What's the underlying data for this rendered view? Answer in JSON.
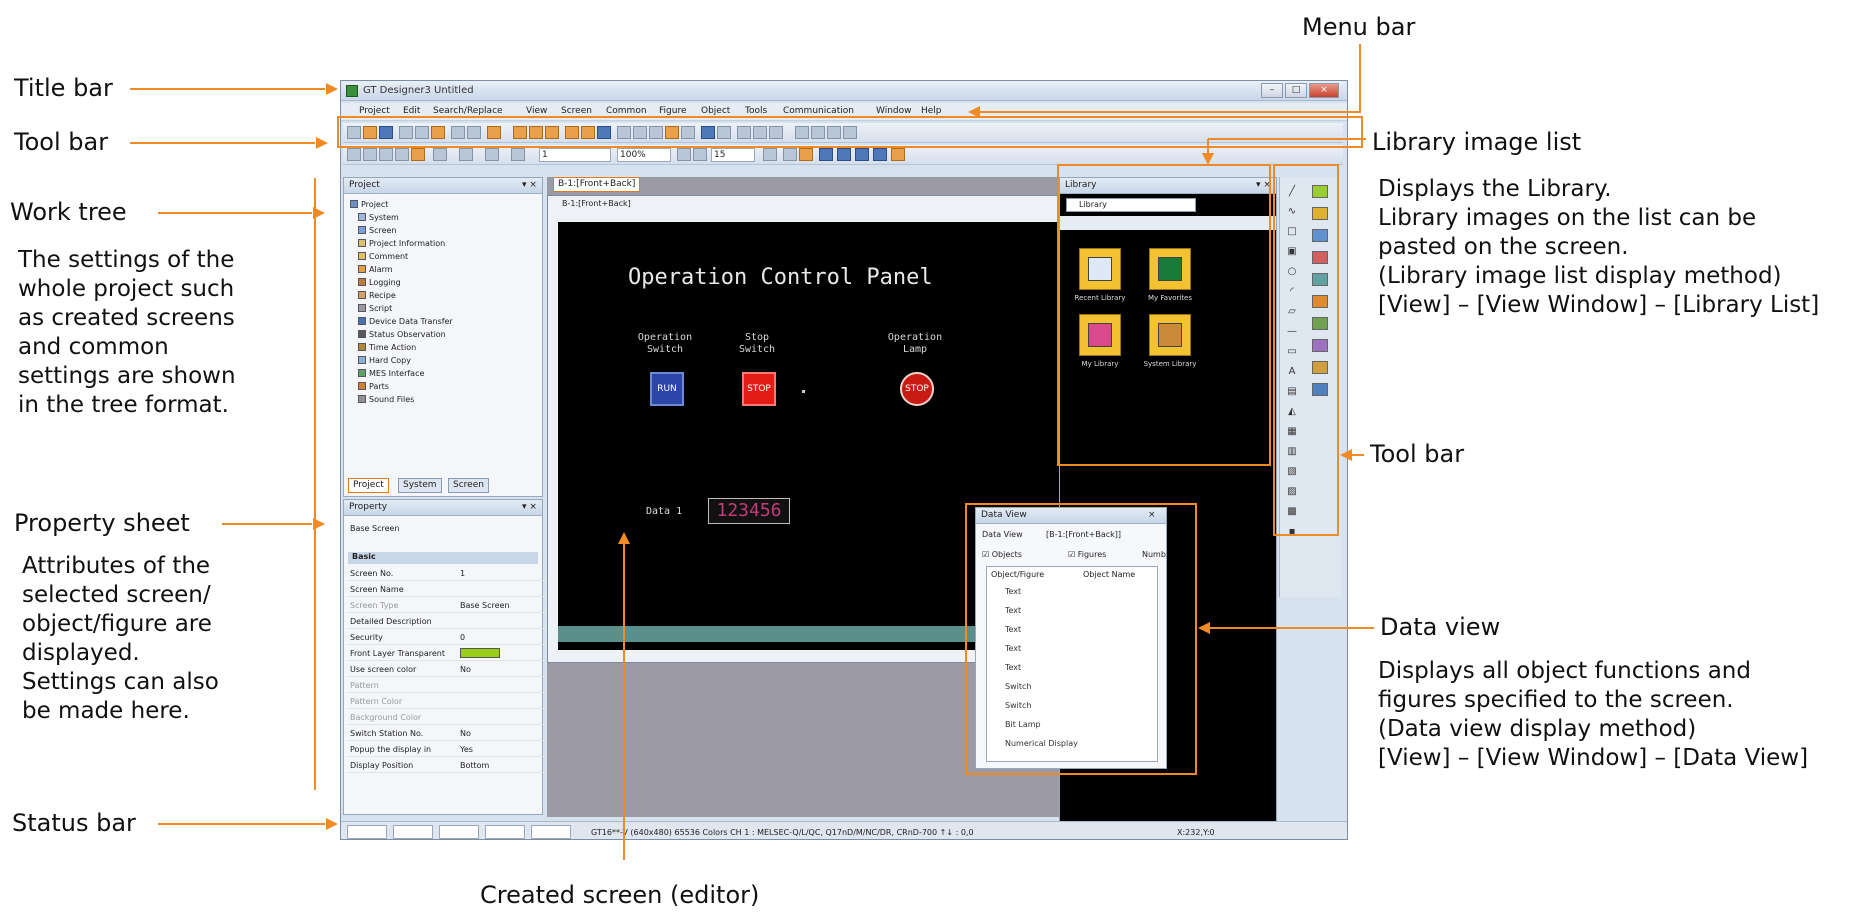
{
  "annotations": {
    "title_bar": "Title bar",
    "tool_bar_left": "Tool bar",
    "work_tree": {
      "label": "Work tree",
      "desc": "The settings of the\nwhole project such\nas created screens\nand common\nsettings are shown\nin the tree format."
    },
    "property_sheet": {
      "label": "Property sheet",
      "desc": "Attributes of the\nselected screen/\nobject/figure are\ndisplayed.\nSettings can also\nbe made here."
    },
    "status_bar": "Status bar",
    "menu_bar": "Menu bar",
    "library_image_list": {
      "label": "Library image list",
      "desc": "Displays the Library.\nLibrary images on the list can be\npasted on the screen.\n(Library image list display method)\n[View] – [View Window] – [Library List]"
    },
    "tool_bar_right": "Tool bar",
    "data_view": {
      "label": "Data view",
      "desc": "Displays all object functions and\nfigures specified to the screen.\n(Data view display method)\n[View] – [View Window] – [Data View]"
    },
    "created_screen": "Created screen (editor)"
  },
  "app": {
    "title": "GT Designer3 Untitled",
    "menu": [
      "Project",
      "Edit",
      "Search/Replace",
      "View",
      "Screen",
      "Common",
      "Figure",
      "Object",
      "Tools",
      "Communication",
      "Window",
      "Help"
    ],
    "toolbar": {
      "font_size": "1",
      "zoom": "100%",
      "layer": "15"
    },
    "project_panel": {
      "title": "Project",
      "items": [
        "Project",
        "System",
        "Screen",
        "Project Information",
        "Comment",
        "Alarm",
        "Logging",
        "Recipe",
        "Script",
        "Device Data Transfer",
        "Status Observation",
        "Time Action",
        "Hard Copy",
        "MES Interface",
        "Parts",
        "Sound Files"
      ],
      "tabs": [
        "Project",
        "System",
        "Screen"
      ]
    },
    "property_panel": {
      "title": "Property",
      "heading": "Base Screen",
      "section": "Basic",
      "rows": [
        {
          "k": "Screen No.",
          "v": "1",
          "dim": false
        },
        {
          "k": "Screen Name",
          "v": "",
          "dim": false
        },
        {
          "k": "Screen Type",
          "v": "Base Screen",
          "dim": true
        },
        {
          "k": "Detailed Description",
          "v": "",
          "dim": false
        },
        {
          "k": "Security",
          "v": "0",
          "dim": false
        },
        {
          "k": "Front Layer Transparent",
          "v": "",
          "dim": false
        },
        {
          "k": "Use screen color",
          "v": "No",
          "dim": false
        },
        {
          "k": "Pattern",
          "v": "",
          "dim": true
        },
        {
          "k": "Pattern Color",
          "v": "",
          "dim": true
        },
        {
          "k": "Background Color",
          "v": "",
          "dim": true
        },
        {
          "k": "Switch Station No.",
          "v": "No",
          "dim": false
        },
        {
          "k": "Popup the display in",
          "v": "Yes",
          "dim": false
        },
        {
          "k": "Display Position",
          "v": "Bottom",
          "dim": false
        }
      ]
    },
    "editor": {
      "tab": "B-1:[Front+Back]",
      "inner_title": "B-1:[Front+Back]",
      "screen_title": "Operation Control Panel",
      "labels": {
        "op_switch": "Operation\nSwitch",
        "stop_switch": "Stop\nSwitch",
        "op_lamp": "Operation\nLamp"
      },
      "run": "RUN",
      "stop": "STOP",
      "lamp": "STOP",
      "data_label": "Data 1",
      "data_value": "123456"
    },
    "library": {
      "title": "Library",
      "dropdown": "Library",
      "items": [
        "Recent Library",
        "My Favorites",
        "My Library",
        "System Library"
      ]
    },
    "data_view": {
      "title": "Data View",
      "label": "Data View",
      "target": "[B-1:[Front+Back]]",
      "check_objects": "Objects",
      "check_figures": "Figures",
      "check_num": "Numb",
      "col1": "Object/Figure",
      "col2": "Object Name",
      "rows": [
        "Text",
        "Text",
        "Text",
        "Text",
        "Text",
        "Switch",
        "Switch",
        "Bit Lamp",
        "Numerical Display"
      ]
    },
    "status": {
      "text": "GT16**-V (640x480)  65536 Colors  CH 1 : MELSEC-Q/L/QC, Q17nD/M/NC/DR, CRnD-700  ↑↓ : 0,0",
      "coords": "X:232,Y:0"
    }
  },
  "colors": {
    "accent": "#f08a24"
  }
}
